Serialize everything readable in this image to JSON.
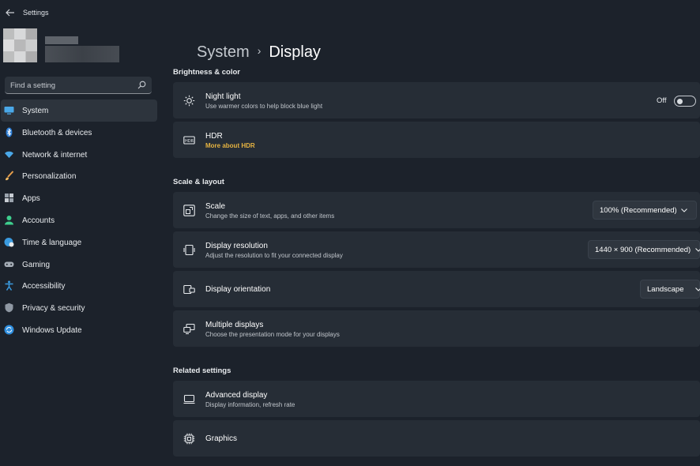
{
  "window": {
    "title": "Settings"
  },
  "search": {
    "placeholder": "Find a setting"
  },
  "sidebar": {
    "items": [
      {
        "label": "System",
        "icon": "system-icon",
        "active": true
      },
      {
        "label": "Bluetooth & devices",
        "icon": "bluetooth-icon"
      },
      {
        "label": "Network & internet",
        "icon": "wifi-icon"
      },
      {
        "label": "Personalization",
        "icon": "brush-icon"
      },
      {
        "label": "Apps",
        "icon": "apps-icon"
      },
      {
        "label": "Accounts",
        "icon": "accounts-icon"
      },
      {
        "label": "Time & language",
        "icon": "globe-clock-icon"
      },
      {
        "label": "Gaming",
        "icon": "gamepad-icon"
      },
      {
        "label": "Accessibility",
        "icon": "accessibility-icon"
      },
      {
        "label": "Privacy & security",
        "icon": "shield-icon"
      },
      {
        "label": "Windows Update",
        "icon": "update-icon"
      }
    ]
  },
  "breadcrumb": {
    "parent": "System",
    "separator": "›",
    "current": "Display"
  },
  "sections": {
    "brightness": "Brightness & color",
    "scale_layout": "Scale & layout",
    "related": "Related settings"
  },
  "cards": {
    "night_light": {
      "title": "Night light",
      "subtitle": "Use warmer colors to help block blue light",
      "toggle_label": "Off",
      "toggle_on": false
    },
    "hdr": {
      "title": "HDR",
      "link": "More about HDR"
    },
    "scale": {
      "title": "Scale",
      "subtitle": "Change the size of text, apps, and other items",
      "value": "100% (Recommended)"
    },
    "resolution": {
      "title": "Display resolution",
      "subtitle": "Adjust the resolution to fit your connected display",
      "value": "1440 × 900 (Recommended)"
    },
    "orientation": {
      "title": "Display orientation",
      "value": "Landscape"
    },
    "multiple": {
      "title": "Multiple displays",
      "subtitle": "Choose the presentation mode for your displays"
    },
    "advanced": {
      "title": "Advanced display",
      "subtitle": "Display information, refresh rate"
    },
    "graphics": {
      "title": "Graphics"
    }
  },
  "colors": {
    "background": "#1c222b",
    "card": "#262d36",
    "accent_link": "#e6b341"
  }
}
